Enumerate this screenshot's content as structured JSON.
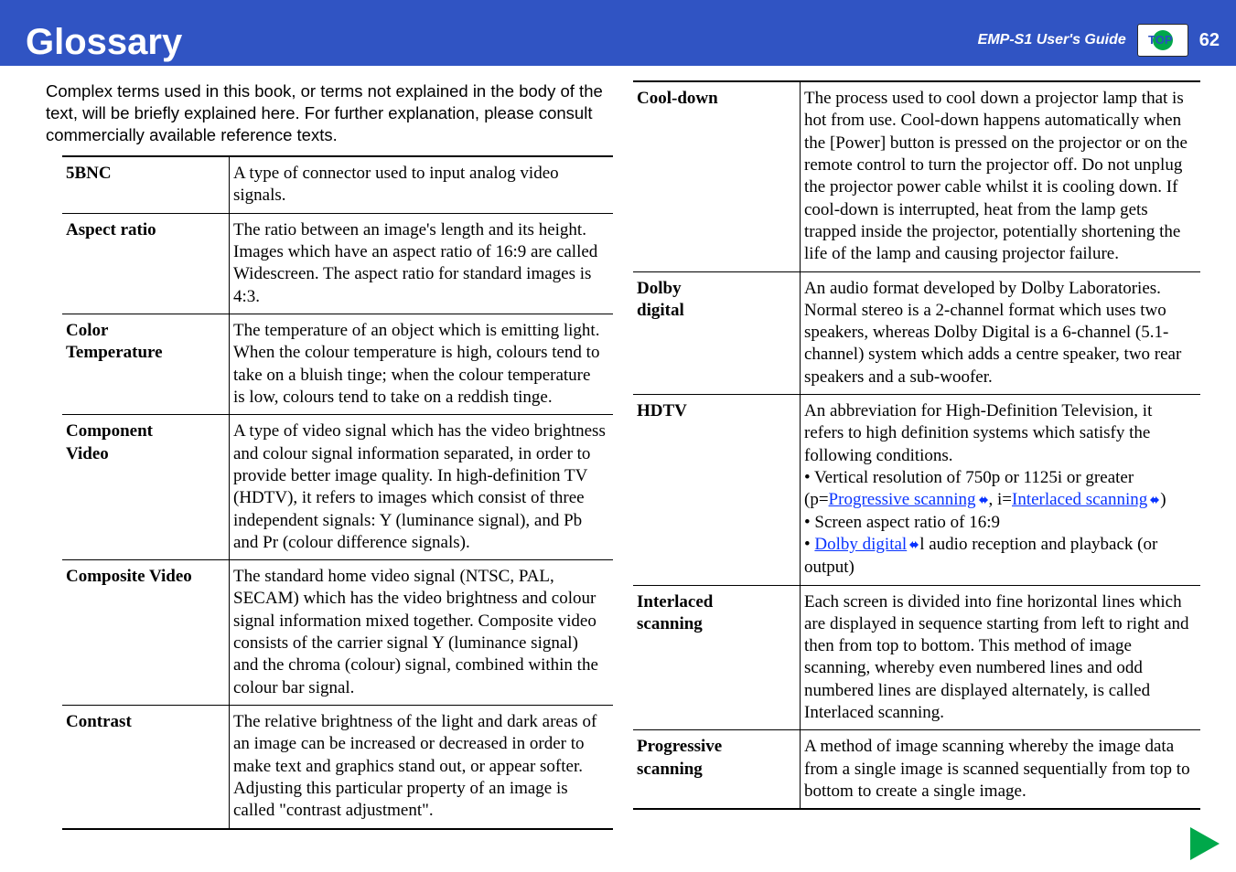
{
  "header": {
    "title": "Glossary",
    "guide": "EMP-S1 User's Guide",
    "top_label": "TOP",
    "page_number": "62"
  },
  "intro": "Complex terms used in this book, or terms not explained in the body of the text, will be briefly explained here. For further explanation, please consult commercially available reference texts.",
  "left_table": [
    {
      "term": "5BNC",
      "def": "A type of connector used to input analog video signals."
    },
    {
      "term": "Aspect ratio",
      "def": "The ratio between an image's length and its height. Images which have an aspect ratio of 16:9 are called Widescreen. The aspect ratio for standard images is 4:3."
    },
    {
      "term": "Color\nTemperature",
      "def": "The temperature of an object which is emitting light. When the colour temperature is high, colours tend to take on a bluish tinge; when the colour temperature is low, colours tend to take on a reddish tinge."
    },
    {
      "term": "Component\nVideo",
      "def": "A type of video signal which has the video brightness and colour signal information separated, in order to provide better image quality. In high-definition TV (HDTV), it refers to images which consist of three independent signals: Y (luminance signal), and Pb and Pr (colour difference signals)."
    },
    {
      "term": "Composite Video",
      "def": "The standard home video signal (NTSC, PAL, SECAM) which has the video brightness and colour signal information mixed together. Composite video consists of the carrier signal Y (luminance signal) and the chroma (colour) signal, combined within the colour bar signal."
    },
    {
      "term": "Contrast",
      "def": "The relative brightness of the light and dark areas of an image can be increased or decreased in order to make text and graphics stand out, or appear softer. Adjusting this particular property of an image is called \"contrast adjustment\"."
    }
  ],
  "right_table": [
    {
      "term": "Cool-down",
      "def": "The process used to cool down a projector lamp that is hot from use. Cool-down happens automatically when the [Power] button is pressed on the projector or on the remote control to turn the projector off. Do not unplug the projector power cable whilst it is cooling down. If cool-down is interrupted, heat from the lamp gets trapped inside the projector, potentially shortening the life of the lamp and causing projector failure."
    },
    {
      "term": "Dolby\ndigital",
      "def": "An audio format developed by Dolby Laboratories. Normal stereo is a 2-channel format which uses two speakers, whereas Dolby Digital is a 6-channel (5.1-channel) system which adds a centre speaker, two rear speakers and a sub-woofer."
    },
    {
      "term": "HDTV",
      "def_pre": "An abbreviation for High-Definition Television, it refers to high definition systems which satisfy the following conditions.",
      "bullet1": "• Vertical resolution of 750p or 1125i or greater",
      "paren_open": "(p=",
      "link_prog": "Progressive scanning",
      "paren_mid": ", i=",
      "link_inter": "Interlaced scanning",
      "paren_close": ")",
      "bullet2": "• Screen aspect ratio of 16:9",
      "bullet3_pre": "• ",
      "link_dolby": "Dolby digital",
      "bullet3_post": "l audio reception and playback (or output)"
    },
    {
      "term": "Interlaced\nscanning",
      "def": "Each screen is divided into fine horizontal lines which are displayed in sequence starting from left to right and then from top to bottom. This method of image scanning, whereby even numbered lines and odd numbered lines are displayed alternately, is called Interlaced scanning."
    },
    {
      "term": "Progressive\nscanning",
      "def": "A method of image scanning whereby the image data from a single image is scanned sequentially from top to bottom to create a single image."
    }
  ]
}
